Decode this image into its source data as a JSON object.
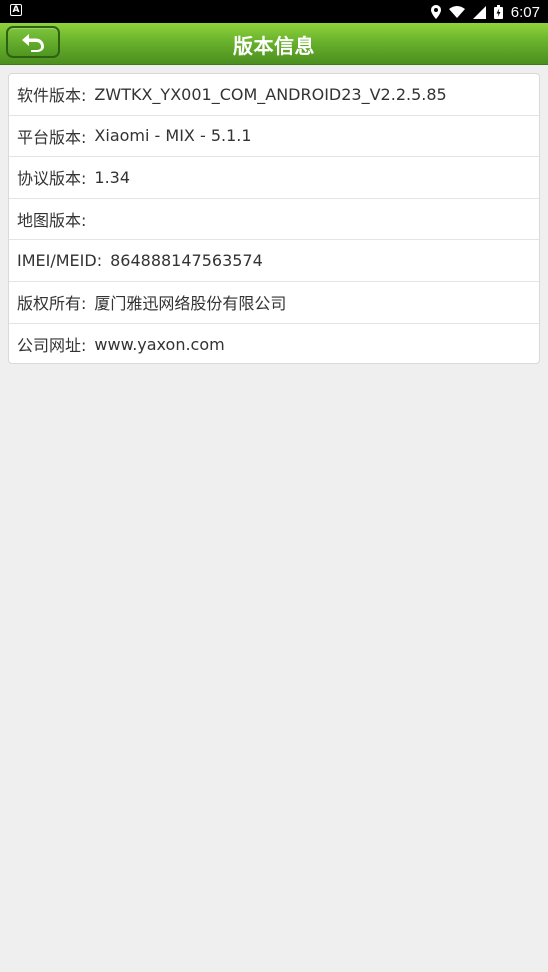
{
  "status_bar": {
    "time": "6:07"
  },
  "header": {
    "title": "版本信息"
  },
  "info": {
    "items": [
      {
        "label": "软件版本:",
        "value": "ZWTKX_YX001_COM_ANDROID23_V2.2.5.85"
      },
      {
        "label": "平台版本:",
        "value": "Xiaomi - MIX - 5.1.1"
      },
      {
        "label": "协议版本:",
        "value": "1.34"
      },
      {
        "label": "地图版本:",
        "value": ""
      },
      {
        "label": "IMEI/MEID:",
        "value": "864888147563574"
      },
      {
        "label": "版权所有:",
        "value": "厦门雅迅网络股份有限公司"
      },
      {
        "label": "公司网址:",
        "value": "www.yaxon.com"
      }
    ]
  }
}
